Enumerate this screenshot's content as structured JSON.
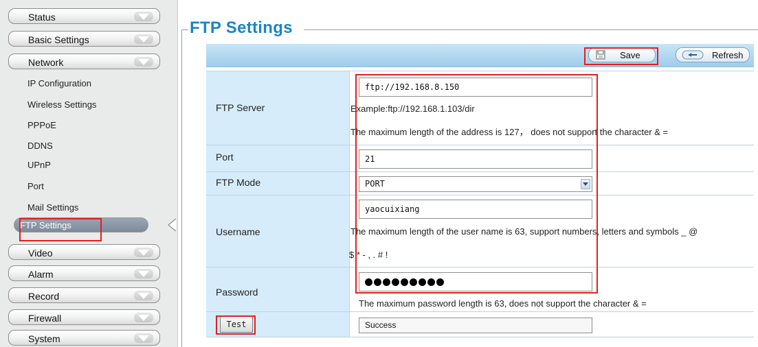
{
  "sidebar": {
    "menu": {
      "status": "Status",
      "basic_settings": "Basic Settings",
      "network": "Network",
      "video": "Video",
      "alarm": "Alarm",
      "record": "Record",
      "firewall": "Firewall",
      "system": "System"
    },
    "network_items": {
      "ip": "IP Configuration",
      "wireless": "Wireless Settings",
      "pppoe": "PPPoE",
      "ddns": "DDNS",
      "upnp": "UPnP",
      "port": "Port",
      "mail": "Mail Settings",
      "ftp": "FTP Settings"
    }
  },
  "page": {
    "title": "FTP Settings"
  },
  "toolbar": {
    "save_label": "Save",
    "refresh_label": "Refresh"
  },
  "form": {
    "ftp_server": {
      "label": "FTP Server",
      "value": "ftp://192.168.8.150",
      "example": "Example:ftp://192.168.1.103/dir",
      "note": "The maximum length of the address is 127， does not support the character & ="
    },
    "port": {
      "label": "Port",
      "value": "21"
    },
    "ftp_mode": {
      "label": "FTP Mode",
      "value": "PORT"
    },
    "username": {
      "label": "Username",
      "value": "yaocuixiang",
      "note_line1": "The maximum length of the user name is 63, support numbers, letters and symbols _ @",
      "note_line2": "$ * - , . # !"
    },
    "password": {
      "label": "Password",
      "note": "The maximum password length is 63, does not support the character & ="
    },
    "test": {
      "button_label": "Test",
      "result": "Success"
    }
  },
  "colors": {
    "title": "#1c84c6",
    "highlight": "#e02020",
    "toolbar": "#a9d3ef",
    "label_cell": "#d6ecfb"
  }
}
